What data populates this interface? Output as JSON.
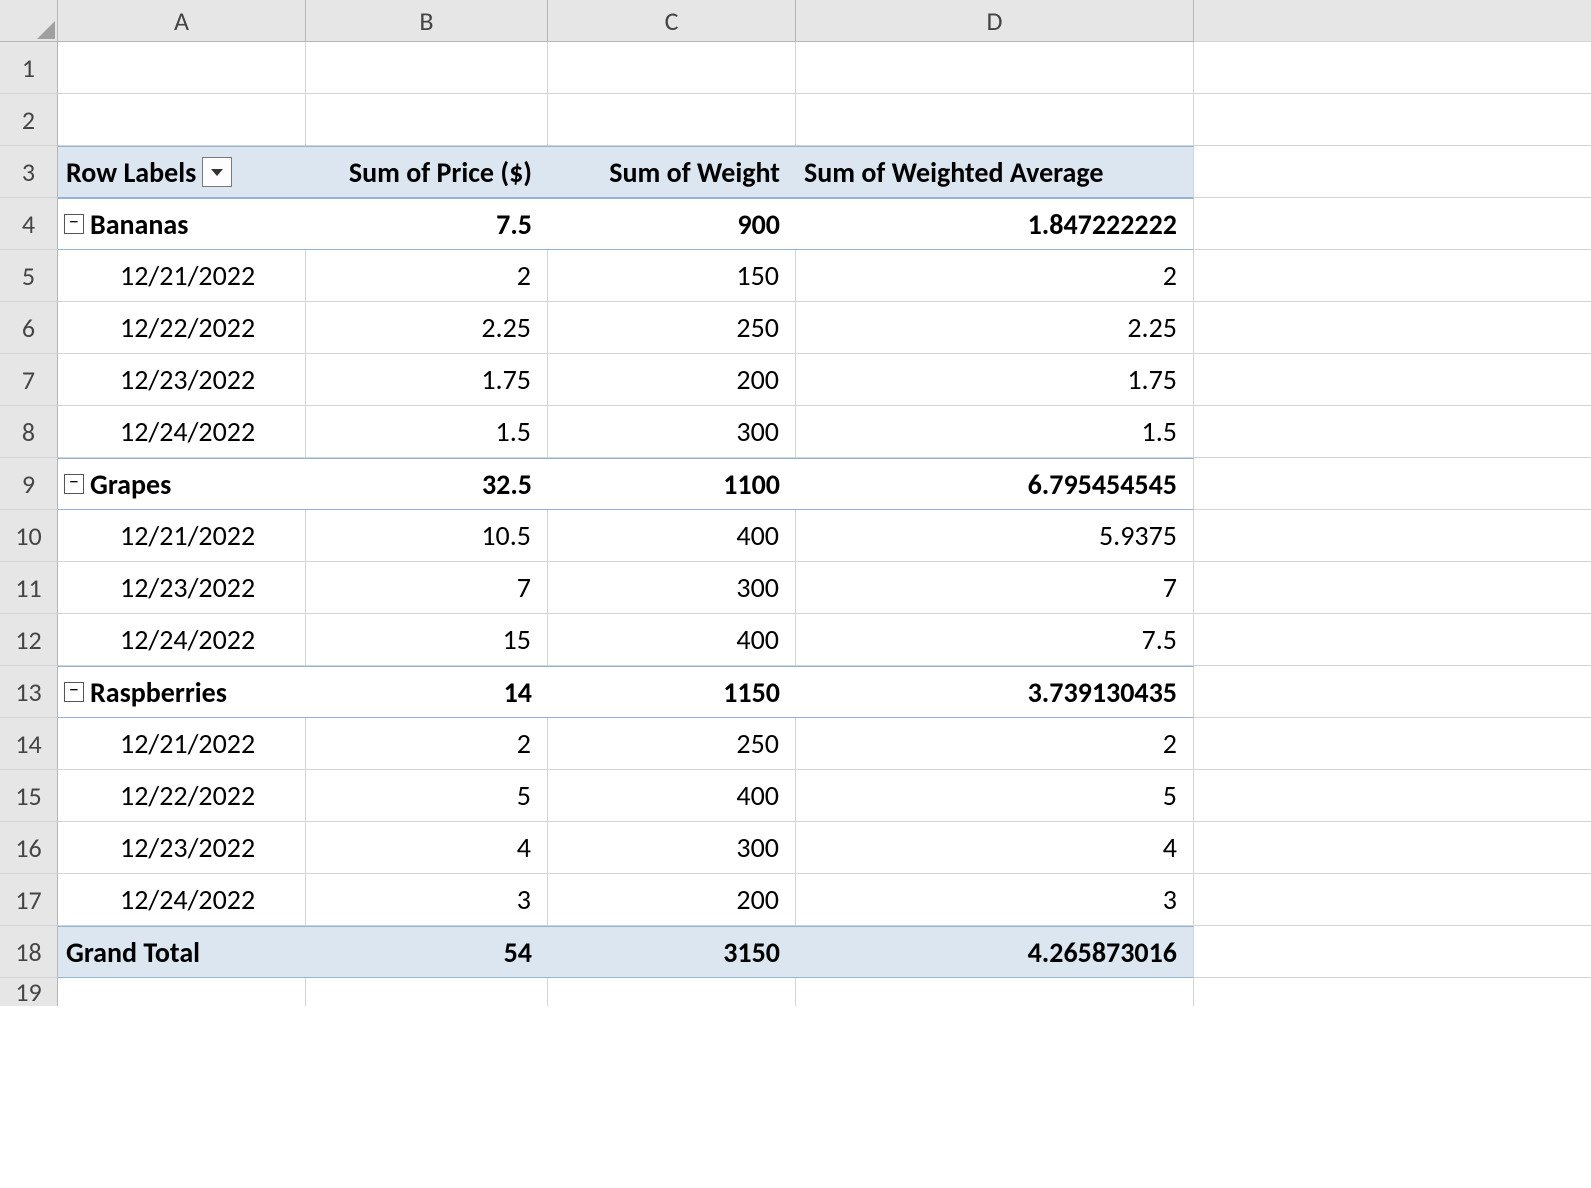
{
  "columns": [
    "A",
    "B",
    "C",
    "D"
  ],
  "row_numbers": [
    "1",
    "2",
    "3",
    "4",
    "5",
    "6",
    "7",
    "8",
    "9",
    "10",
    "11",
    "12",
    "13",
    "14",
    "15",
    "16",
    "17",
    "18",
    "19"
  ],
  "pivot": {
    "headers": {
      "row_labels": "Row Labels",
      "price": "Sum of Price ($)",
      "weight": "Sum of Weight",
      "weighted_avg": "Sum of Weighted Average"
    },
    "groups": [
      {
        "name": "Bananas",
        "price": "7.5",
        "weight": "900",
        "weighted_avg": "1.847222222",
        "details": [
          {
            "date": "12/21/2022",
            "price": "2",
            "weight": "150",
            "weighted_avg": "2"
          },
          {
            "date": "12/22/2022",
            "price": "2.25",
            "weight": "250",
            "weighted_avg": "2.25"
          },
          {
            "date": "12/23/2022",
            "price": "1.75",
            "weight": "200",
            "weighted_avg": "1.75"
          },
          {
            "date": "12/24/2022",
            "price": "1.5",
            "weight": "300",
            "weighted_avg": "1.5"
          }
        ]
      },
      {
        "name": "Grapes",
        "price": "32.5",
        "weight": "1100",
        "weighted_avg": "6.795454545",
        "details": [
          {
            "date": "12/21/2022",
            "price": "10.5",
            "weight": "400",
            "weighted_avg": "5.9375"
          },
          {
            "date": "12/23/2022",
            "price": "7",
            "weight": "300",
            "weighted_avg": "7"
          },
          {
            "date": "12/24/2022",
            "price": "15",
            "weight": "400",
            "weighted_avg": "7.5"
          }
        ]
      },
      {
        "name": "Raspberries",
        "price": "14",
        "weight": "1150",
        "weighted_avg": "3.739130435",
        "details": [
          {
            "date": "12/21/2022",
            "price": "2",
            "weight": "250",
            "weighted_avg": "2"
          },
          {
            "date": "12/22/2022",
            "price": "5",
            "weight": "400",
            "weighted_avg": "5"
          },
          {
            "date": "12/23/2022",
            "price": "4",
            "weight": "300",
            "weighted_avg": "4"
          },
          {
            "date": "12/24/2022",
            "price": "3",
            "weight": "200",
            "weighted_avg": "3"
          }
        ]
      }
    ],
    "grand_total": {
      "label": "Grand Total",
      "price": "54",
      "weight": "3150",
      "weighted_avg": "4.265873016"
    }
  }
}
